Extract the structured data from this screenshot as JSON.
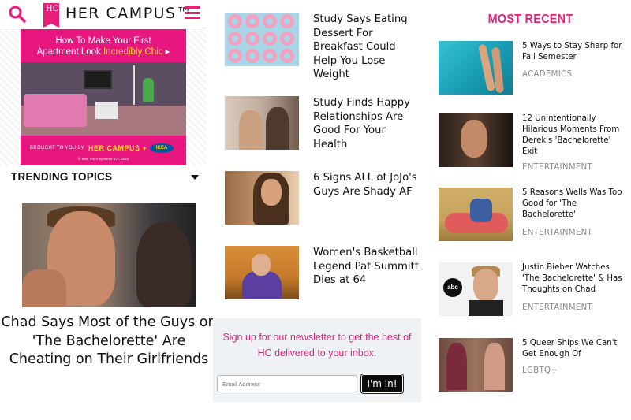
{
  "header": {
    "logo_badge": "HC",
    "logo_text": "HER CAMPUS™",
    "search_icon": "search-icon",
    "menu_icon": "hamburger-menu-icon"
  },
  "ad": {
    "headline_line1": "How To Make Your First",
    "headline_line2_a": "Apartment Look ",
    "headline_line2_b": "Incredibly Chic",
    "headline_arrow": "▸",
    "brought_by": "BROUGHT TO YOU BY",
    "brand": "HER CAMPUS",
    "plus": "+",
    "sponsor": "IKEA",
    "copyright": "© Inter IKEA Systems B.V. 2016"
  },
  "trending": {
    "title": "TRENDING TOPICS",
    "featured_title": "Chad Says Most of the Guys on 'The Bachelorette' Are Cheating on Their Girlfriends"
  },
  "articles": [
    {
      "title": "Study Says Eating Dessert For Breakfast Could Help You Lose Weight"
    },
    {
      "title": "Study Finds Happy Relationships Are Good For Your Health"
    },
    {
      "title": "6 Signs ALL of JoJo's Guys Are Shady AF"
    },
    {
      "title": "Women's Basketball Legend Pat Summitt Dies at 64"
    }
  ],
  "newsletter": {
    "text": "Sign up for our newsletter to get the best of HC delivered to your inbox.",
    "placeholder": "Email Address",
    "button": "I'm in!"
  },
  "most_recent": {
    "title": "MOST RECENT",
    "items": [
      {
        "title": "5 Ways to Stay Sharp for Fall Semester",
        "category": "ACADEMICS"
      },
      {
        "title": "12 Unintentionally Hilarious Moments From Derek's 'Bachelorette' Exit",
        "category": "ENTERTAINMENT"
      },
      {
        "title": "5 Reasons Wells Was Too Good for 'The Bachelorette'",
        "category": "ENTERTAINMENT"
      },
      {
        "title": "Justin Bieber Watches 'The Bachelorette' & Has Thoughts on Chad",
        "category": "ENTERTAINMENT"
      },
      {
        "title": "5 Queer Ships We Can't Get Enough Of",
        "category": "LGBTQ+"
      }
    ]
  },
  "colors": {
    "accent": "#e91e7a",
    "ad_bg": "#e8177f",
    "ad_highlight": "#ffe11a",
    "newsletter_bg": "#eef2f5",
    "category_gray": "#8a8a8a"
  }
}
